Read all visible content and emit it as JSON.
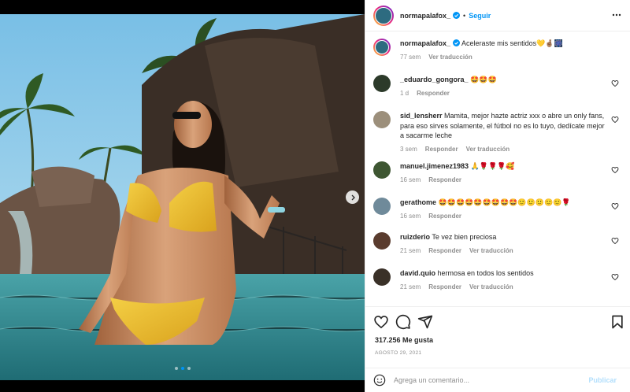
{
  "post_user": "normapalafox_",
  "header": {
    "separator": "•",
    "follow_label": "Seguir"
  },
  "caption": {
    "username": "normapalafox_",
    "text": "Aceleraste mis sentidos💛🤞🏽🎆",
    "time": "77 sem",
    "translate": "Ver traducción"
  },
  "comments": [
    {
      "username": "_eduardo_gongora_",
      "text": "🤩🤩🤩",
      "time": "1 d",
      "reply": "Responder",
      "translate": ""
    },
    {
      "username": "sid_lensherr",
      "text": "Mamita, mejor hazte actriz xxx o abre un only fans, para eso sirves solamente, el fútbol no es lo tuyo, dedícate mejor a sacarme leche",
      "time": "3 sem",
      "reply": "Responder",
      "translate": "Ver traducción"
    },
    {
      "username": "manuel.jimenez1983",
      "text": "🙏🌹🌹🌹🥰",
      "time": "16 sem",
      "reply": "Responder",
      "translate": ""
    },
    {
      "username": "gerathome",
      "text": "🤩🤩🤩🤩🤩🤩🤩🤩🤩🙂🙂🙂🙂🙂🌹",
      "time": "16 sem",
      "reply": "Responder",
      "translate": ""
    },
    {
      "username": "ruizderio",
      "text": "Te vez bien preciosa",
      "time": "21 sem",
      "reply": "Responder",
      "translate": "Ver traducción"
    },
    {
      "username": "david.quio",
      "text": "hermosa en todos los sentidos",
      "time": "21 sem",
      "reply": "Responder",
      "translate": "Ver traducción"
    }
  ],
  "likes_text": "317.256 Me gusta",
  "date_text": "AGOSTO 29, 2021",
  "composer": {
    "placeholder": "Agrega un comentario...",
    "publish_label": "Publicar"
  },
  "colors": {
    "accent": "#0095f6",
    "muted": "#8e8e8e",
    "text": "#262626",
    "border": "#efefef"
  },
  "icons": [
    "verified-icon",
    "more-options-icon",
    "heart-icon",
    "comment-icon",
    "share-icon",
    "bookmark-icon",
    "emoji-icon",
    "chevron-right-icon"
  ],
  "carousel": {
    "slides": 3,
    "active": 1
  }
}
